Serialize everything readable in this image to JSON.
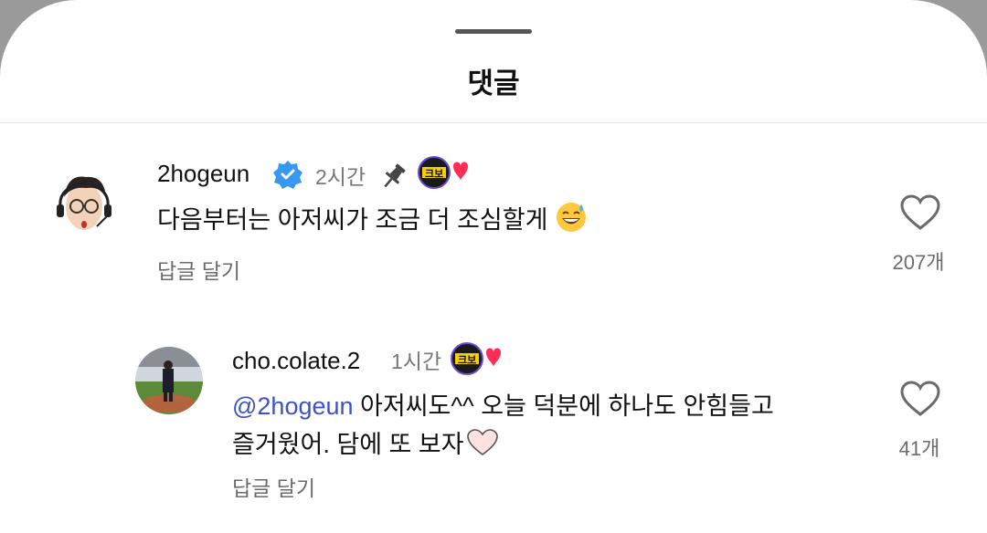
{
  "sheet": {
    "title": "댓글"
  },
  "comments": [
    {
      "username": "2hogeun",
      "time": "2시간",
      "verified": true,
      "pinned": true,
      "text": "다음부터는 아저씨가 조금 더 조심할게",
      "emoji": "sweat-smile-emoji",
      "reply_label": "답글 달기",
      "like_count": "207개",
      "badge_text": "크보"
    },
    {
      "username": "cho.colate.2",
      "time": "1시간",
      "mention": "@2hogeun",
      "text_line1": " 아저씨도^^ 오늘 덕분에 하나도 안힘들고",
      "text_line2": "즐거웠어. 담에 또 보자",
      "reply_label": "답글 달기",
      "like_count": "41개",
      "badge_text": "크보"
    }
  ],
  "colors": {
    "mention": "#3b52c7",
    "verified": "#3897f0",
    "badge_heart": "#ff2d55"
  }
}
